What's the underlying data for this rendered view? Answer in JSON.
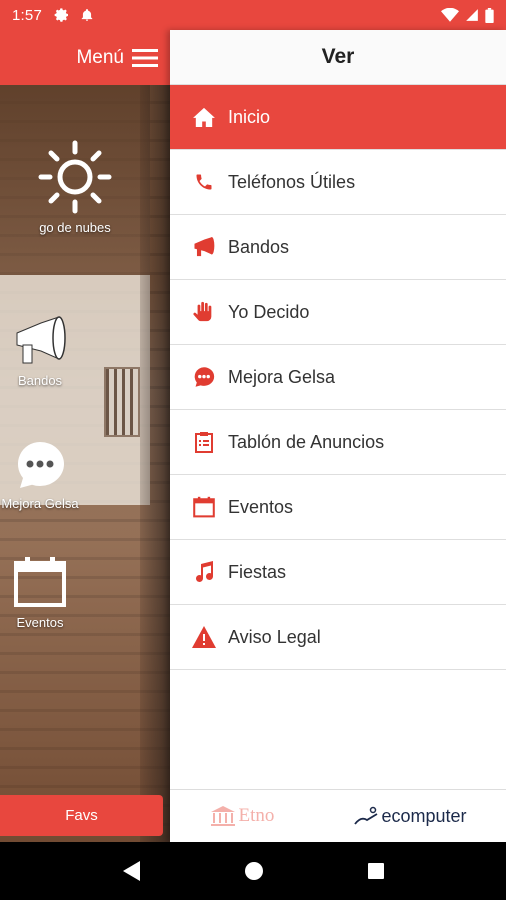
{
  "status_bar": {
    "time": "1:57"
  },
  "left_app": {
    "menu_label": "Menú",
    "items": [
      {
        "label": "go de nubes",
        "icon": "sun-icon"
      },
      {
        "label": "Bandos",
        "icon": "megaphone-icon"
      },
      {
        "label": "Mejora Gelsa",
        "icon": "chat-bubble-icon"
      },
      {
        "label": "Eventos",
        "icon": "calendar-icon"
      }
    ],
    "favs_label": "Favs"
  },
  "drawer": {
    "title": "Ver",
    "items": [
      {
        "label": "Inicio",
        "icon": "home-icon",
        "active": true
      },
      {
        "label": "Teléfonos Útiles",
        "icon": "phone-icon"
      },
      {
        "label": "Bandos",
        "icon": "megaphone-icon"
      },
      {
        "label": "Yo Decido",
        "icon": "hand-icon"
      },
      {
        "label": "Mejora Gelsa",
        "icon": "chat-bubble-icon"
      },
      {
        "label": "Tablón de Anuncios",
        "icon": "clipboard-icon"
      },
      {
        "label": "Eventos",
        "icon": "calendar-icon"
      },
      {
        "label": "Fiestas",
        "icon": "music-note-icon"
      },
      {
        "label": "Aviso Legal",
        "icon": "warning-icon"
      }
    ],
    "footer": {
      "left_logo": "Etno",
      "right_logo": "ecomputer"
    }
  },
  "colors": {
    "accent": "#e8473e",
    "icon_red": "#e03c31"
  }
}
